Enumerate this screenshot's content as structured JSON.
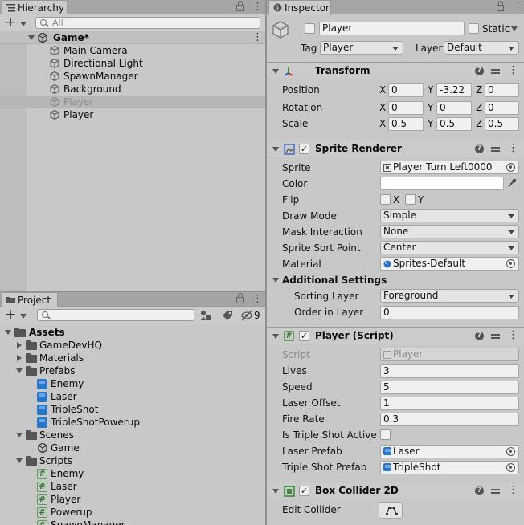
{
  "hierarchy": {
    "tab": "Hierarchy",
    "search_placeholder": "All",
    "scene": "Game*",
    "items": [
      "Main Camera",
      "Directional Light",
      "SpawnManager",
      "Background",
      "Player",
      "Player"
    ]
  },
  "project": {
    "tab": "Project",
    "hidden_count": "9",
    "tree": {
      "assets": "Assets",
      "gamedevhq": "GameDevHQ",
      "materials": "Materials",
      "prefabs": "Prefabs",
      "prefab_items": [
        "Enemy",
        "Laser",
        "TripleShot",
        "TripleShotPowerup"
      ],
      "scenes": "Scenes",
      "scene_items": [
        "Game"
      ],
      "scripts": "Scripts",
      "script_items": [
        "Enemy",
        "Laser",
        "Player",
        "Powerup",
        "SpawnManager"
      ]
    }
  },
  "inspector": {
    "tab": "Inspector",
    "object_name": "Player",
    "static_label": "Static",
    "tag_label": "Tag",
    "tag_value": "Player",
    "layer_label": "Layer",
    "layer_value": "Default",
    "transform": {
      "title": "Transform",
      "position_label": "Position",
      "rotation_label": "Rotation",
      "scale_label": "Scale",
      "position": {
        "x": "0",
        "y": "-3.22",
        "z": "0"
      },
      "rotation": {
        "x": "0",
        "y": "0",
        "z": "0"
      },
      "scale": {
        "x": "0.5",
        "y": "0.5",
        "z": "0.5"
      },
      "axis_x": "X",
      "axis_y": "Y",
      "axis_z": "Z"
    },
    "sprite_renderer": {
      "title": "Sprite Renderer",
      "sprite_label": "Sprite",
      "sprite_value": "Player Turn Left0000",
      "color_label": "Color",
      "flip_label": "Flip",
      "flip_x": "X",
      "flip_y": "Y",
      "draw_mode_label": "Draw Mode",
      "draw_mode_value": "Simple",
      "mask_label": "Mask Interaction",
      "mask_value": "None",
      "sort_point_label": "Sprite Sort Point",
      "sort_point_value": "Center",
      "material_label": "Material",
      "material_value": "Sprites-Default",
      "additional_settings": "Additional Settings",
      "sorting_layer_label": "Sorting Layer",
      "sorting_layer_value": "Foreground",
      "order_label": "Order in Layer",
      "order_value": "0"
    },
    "player_script": {
      "title": "Player (Script)",
      "script_label": "Script",
      "script_value": "Player",
      "lives_label": "Lives",
      "lives_value": "3",
      "speed_label": "Speed",
      "speed_value": "5",
      "laser_offset_label": "Laser Offset",
      "laser_offset_value": "1",
      "fire_rate_label": "Fire Rate",
      "fire_rate_value": "0.3",
      "triple_active_label": "Is Triple Shot Active",
      "laser_prefab_label": "Laser Prefab",
      "laser_prefab_value": "Laser",
      "triple_prefab_label": "Triple Shot Prefab",
      "triple_prefab_value": "TripleShot"
    },
    "box_collider": {
      "title": "Box Collider 2D",
      "edit_label": "Edit Collider"
    }
  },
  "colors": {
    "selected_row": "#b6b6b6",
    "panel_bg": "#c8c8c8",
    "script_green": "#2d7a2a",
    "prefab_blue": "#2b75c7"
  }
}
